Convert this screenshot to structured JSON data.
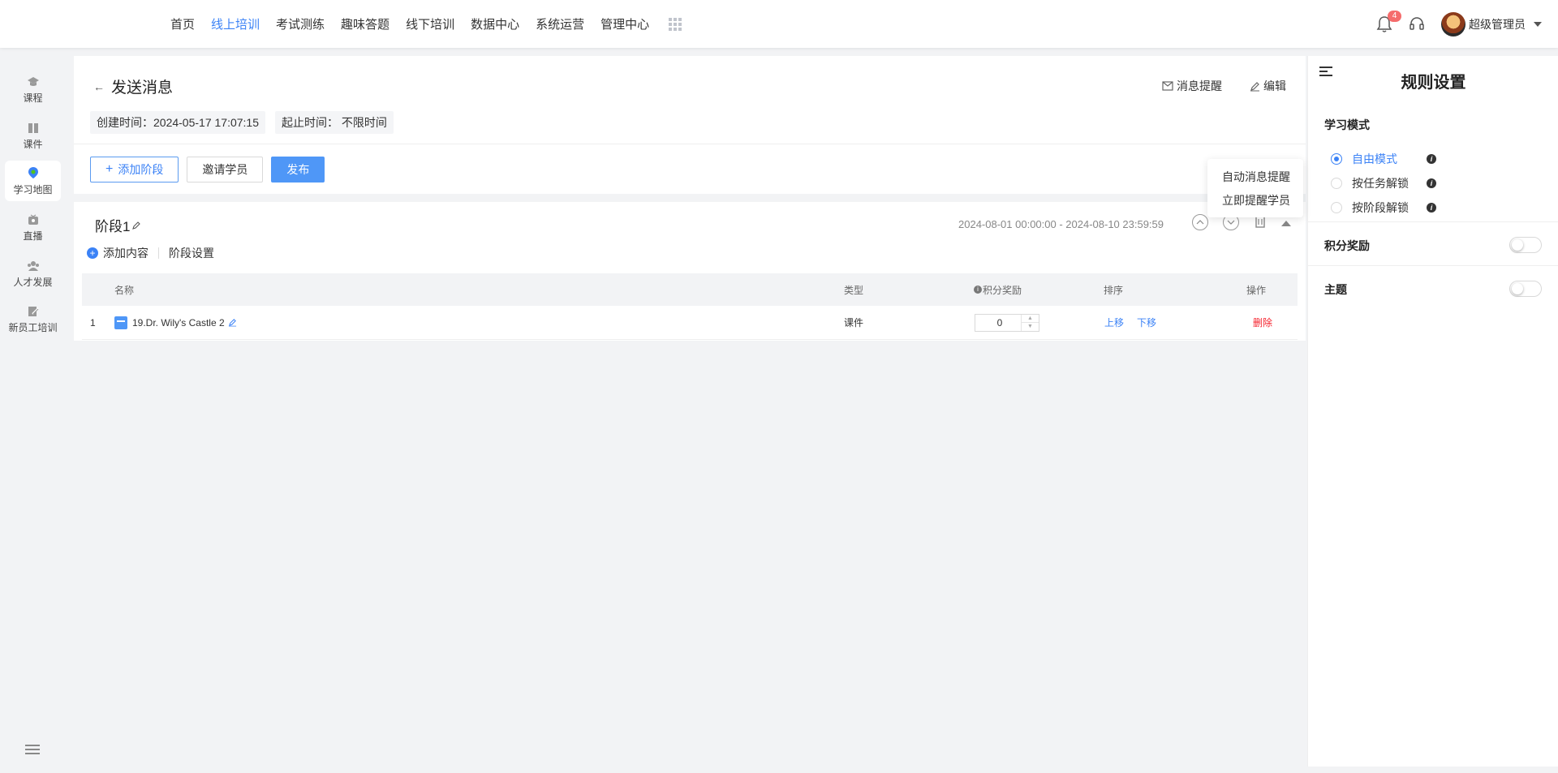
{
  "nav": {
    "items": [
      "首页",
      "线上培训",
      "考试测练",
      "趣味答题",
      "线下培训",
      "数据中心",
      "系统运营",
      "管理中心"
    ],
    "active_index": 1
  },
  "user": {
    "name": "超级管理员",
    "notification_count": "4"
  },
  "sidebar": {
    "items": [
      {
        "label": "课程",
        "icon": "graduation-cap-icon"
      },
      {
        "label": "课件",
        "icon": "book-icon"
      },
      {
        "label": "学习地图",
        "icon": "map-pin-icon"
      },
      {
        "label": "直播",
        "icon": "live-icon"
      },
      {
        "label": "人才发展",
        "icon": "people-icon"
      },
      {
        "label": "新员工培训",
        "icon": "edit-doc-icon"
      }
    ],
    "active_index": 2
  },
  "header": {
    "title": "发送消息",
    "created_label": "创建时间：",
    "created_value": "2024-05-17 17:07:15",
    "period_label": "起止时间：",
    "period_value": "不限时间",
    "message_reminder": "消息提醒",
    "edit": "编辑"
  },
  "buttons": {
    "add_stage": "添加阶段",
    "invite": "邀请学员",
    "publish": "发布"
  },
  "dropdown": {
    "items": [
      "自动消息提醒",
      "立即提醒学员"
    ]
  },
  "stage": {
    "title": "阶段1",
    "date_range": "2024-08-01 00:00:00 - 2024-08-10 23:59:59",
    "add_content": "添加内容",
    "stage_settings": "阶段设置",
    "columns": {
      "name": "名称",
      "type": "类型",
      "points": "积分奖励",
      "order": "排序",
      "ops": "操作"
    },
    "rows": [
      {
        "index": "1",
        "name": "19.Dr. Wily's Castle 2",
        "type": "课件",
        "points": "0",
        "up": "上移",
        "down": "下移",
        "delete": "删除"
      }
    ]
  },
  "rules": {
    "title": "规则设置",
    "learning_mode": "学习模式",
    "modes": [
      "自由模式",
      "按任务解锁",
      "按阶段解锁"
    ],
    "selected_mode": 0,
    "points_reward": "积分奖励",
    "points_enabled": false,
    "theme": "主题",
    "theme_enabled": false
  },
  "colors": {
    "accent": "#3b82f6",
    "danger": "#f5222d"
  }
}
